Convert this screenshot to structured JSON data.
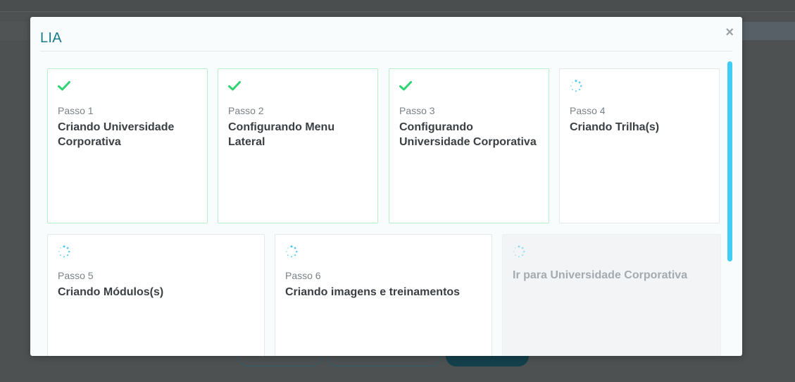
{
  "modal": {
    "title": "LIA",
    "close_label": "×"
  },
  "steps": [
    {
      "step": "Passo 1",
      "title": "Criando Universidade Corporativa",
      "status": "done"
    },
    {
      "step": "Passo 2",
      "title": "Configurando Menu Lateral",
      "status": "done"
    },
    {
      "step": "Passo 3",
      "title": "Configurando Universidade Corporativa",
      "status": "done"
    },
    {
      "step": "Passo 4",
      "title": "Criando Trilha(s)",
      "status": "loading"
    },
    {
      "step": "Passo 5",
      "title": "Criando Módulos(s)",
      "status": "loading"
    },
    {
      "step": "Passo 6",
      "title": "Criando imagens e treinamentos",
      "status": "loading"
    }
  ],
  "final_action": {
    "title": "Ir para Universidade Corporativa",
    "status": "disabled"
  },
  "colors": {
    "accent": "#1c7a8a",
    "done": "#2ed573",
    "spinner": "#48c7ee",
    "scrollbar": "#3fcdf2"
  },
  "icons": {
    "done": "check-icon",
    "loading": "spinner-icon",
    "close": "close-icon"
  }
}
